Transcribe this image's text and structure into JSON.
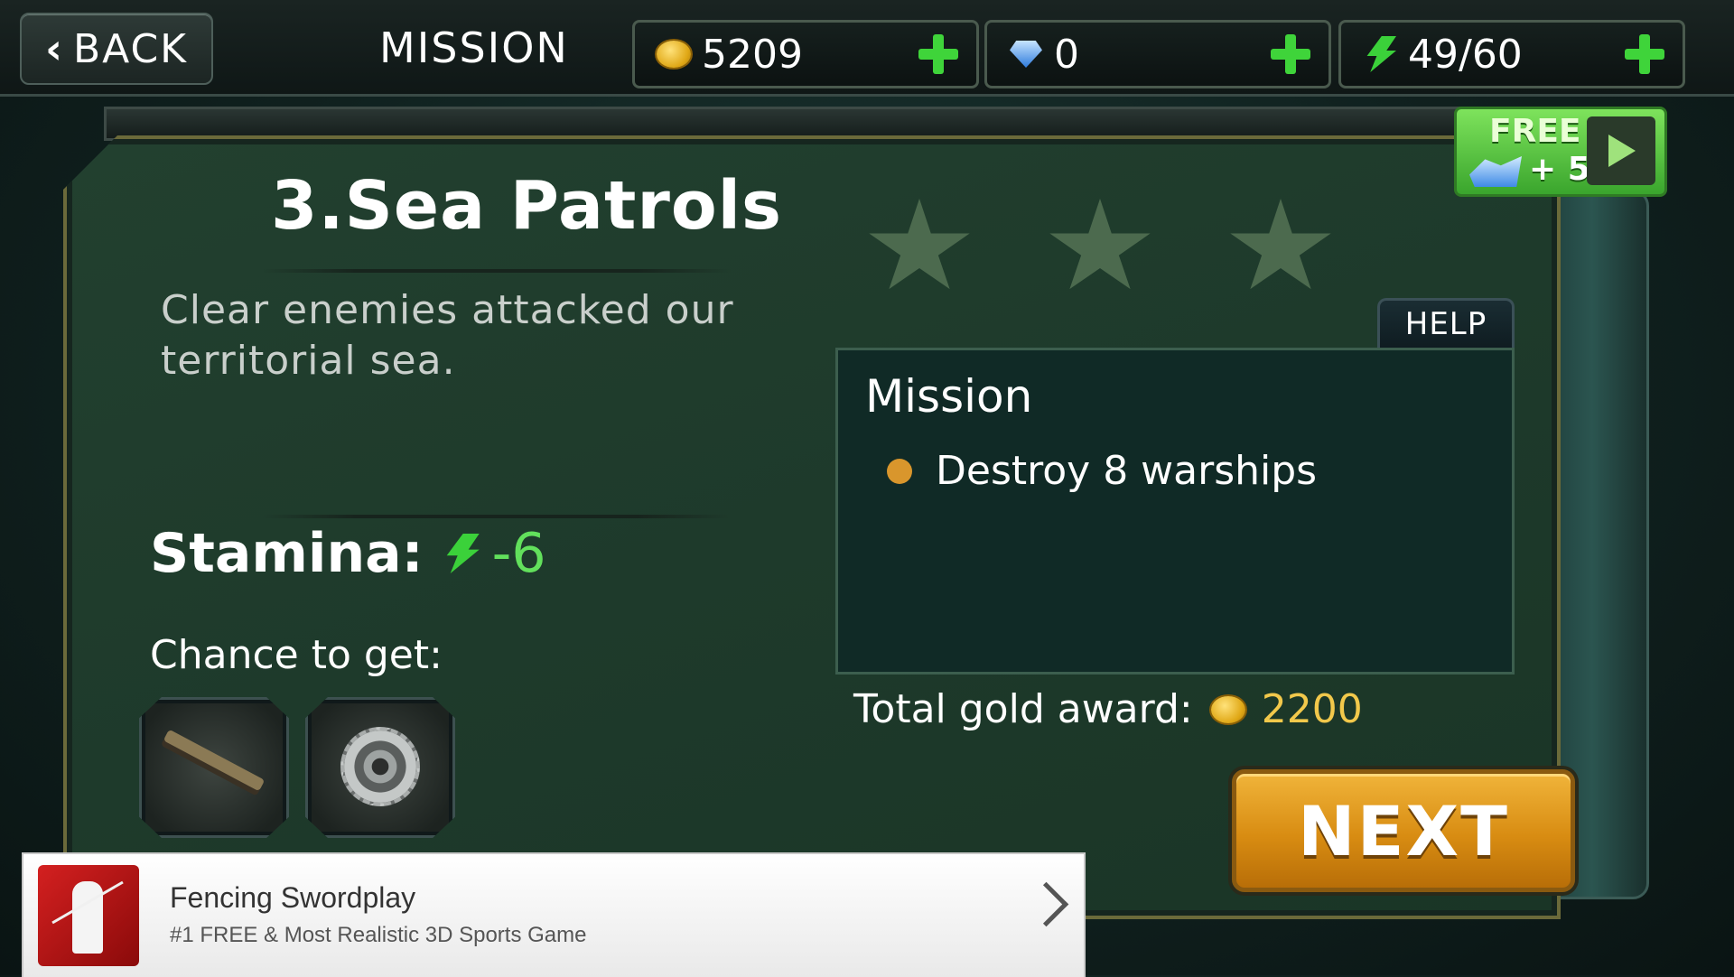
{
  "topbar": {
    "back_label": "BACK",
    "screen_title": "MISSION",
    "gold": "5209",
    "gems": "0",
    "stamina": "49/60"
  },
  "free_offer": {
    "label": "FREE",
    "bonus": "+ 5"
  },
  "mission": {
    "title": "3.Sea Patrols",
    "description": "Clear enemies attacked our territorial sea.",
    "stars_earned": 0,
    "stars_total": 3,
    "stamina_label": "Stamina:",
    "stamina_cost": "-6",
    "chance_label": "Chance to get:",
    "rewards": [
      {
        "name": "rifle-reward",
        "icon": "rifle-icon"
      },
      {
        "name": "gear-reward",
        "icon": "gear-icon"
      }
    ]
  },
  "help_label": "HELP",
  "objectives_box": {
    "title": "Mission",
    "objectives": [
      "Destroy 8 warships"
    ]
  },
  "award": {
    "label": "Total gold award:",
    "amount": "2200"
  },
  "next_label": "NEXT",
  "ad": {
    "title": "Fencing Swordplay",
    "subtitle": "#1 FREE & Most Realistic 3D Sports Game"
  },
  "colors": {
    "accent_green": "#3fd43a",
    "gold": "#f2c84b",
    "next_button": "#d88c12",
    "panel": "#1e3a2b"
  }
}
